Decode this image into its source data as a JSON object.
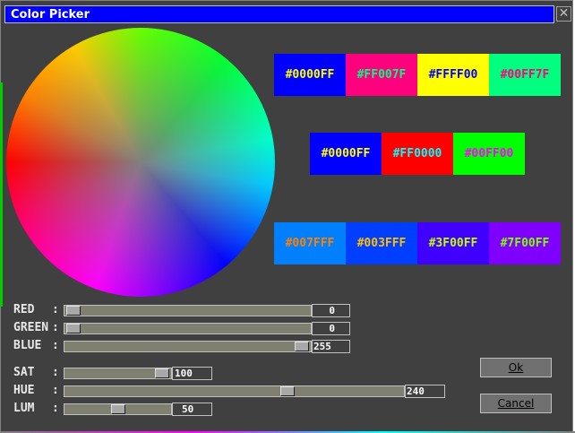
{
  "window": {
    "title": "Color Picker",
    "close_glyph": "✕"
  },
  "swatches": {
    "row1": [
      {
        "label": "#0000FF",
        "bg": "#0000ff",
        "fg": "#ffff00"
      },
      {
        "label": "#FF007F",
        "bg": "#ff007f",
        "fg": "#00ff80"
      },
      {
        "label": "#FFFF00",
        "bg": "#ffff00",
        "fg": "#0000ff"
      },
      {
        "label": "#00FF7F",
        "bg": "#00ff7f",
        "fg": "#ff0080"
      }
    ],
    "row2": [
      {
        "label": "#0000FF",
        "bg": "#0000ff",
        "fg": "#ffff00"
      },
      {
        "label": "#FF0000",
        "bg": "#ff0000",
        "fg": "#00ffff"
      },
      {
        "label": "#00FF00",
        "bg": "#00ff00",
        "fg": "#ff00ff"
      }
    ],
    "row3": [
      {
        "label": "#007FFF",
        "bg": "#007fff",
        "fg": "#ff8000"
      },
      {
        "label": "#003FFF",
        "bg": "#003fff",
        "fg": "#ffc000"
      },
      {
        "label": "#3F00FF",
        "bg": "#3f00ff",
        "fg": "#c0ff00"
      },
      {
        "label": "#7F00FF",
        "bg": "#7f00ff",
        "fg": "#80ff00"
      }
    ]
  },
  "sliders": [
    {
      "label": "RED",
      "value": "0",
      "level": 0.0
    },
    {
      "label": "GREEN",
      "value": "0",
      "level": 0.0
    },
    {
      "label": "BLUE",
      "value": "255",
      "level": 1.0
    },
    {
      "label": "SAT",
      "value": "100",
      "level": 1.0
    },
    {
      "label": "HUE",
      "value": "240",
      "level": 0.667
    },
    {
      "label": "LUM",
      "value": "50",
      "level": 0.5
    }
  ],
  "colon": ":",
  "buttons": {
    "ok": "Ok",
    "cancel": "Cancel"
  },
  "icons": {
    "wheel": "color-wheel-icon"
  }
}
